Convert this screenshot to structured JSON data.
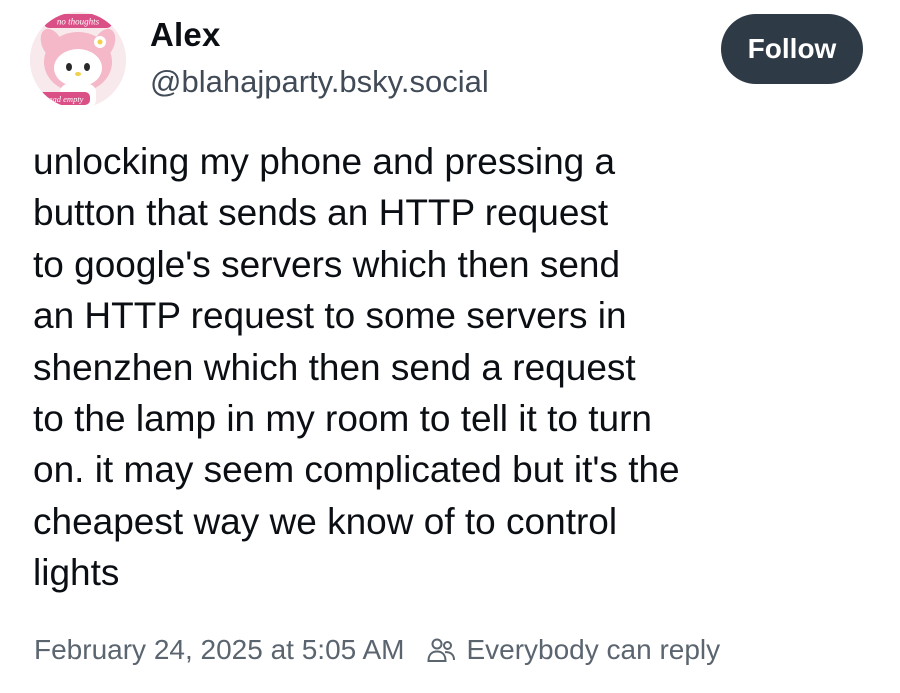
{
  "author": {
    "display_name": "Alex",
    "handle": "@blahajparty.bsky.social",
    "avatar": {
      "icon": "avatar-character-icon",
      "top_text": "no thoughts",
      "bottom_text": "head empty"
    }
  },
  "follow_button": {
    "label": "Follow"
  },
  "post": {
    "lines": [
      "unlocking my phone and pressing a",
      "button that sends an HTTP request",
      "to google's servers which then send",
      "an HTTP request to some servers in",
      "shenzhen which then send a request",
      "to the lamp in my room to tell it to turn",
      "on. it may seem complicated but it's the",
      "cheapest way we know of to control",
      "lights"
    ]
  },
  "meta": {
    "timestamp": "February 24, 2025 at 5:05 AM",
    "reply_icon": "people-icon",
    "reply_setting": "Everybody can reply"
  },
  "colors": {
    "text": "#0b0f14",
    "secondary": "#5b6570",
    "follow_bg": "#2f3a47",
    "follow_text": "#ffffff"
  }
}
